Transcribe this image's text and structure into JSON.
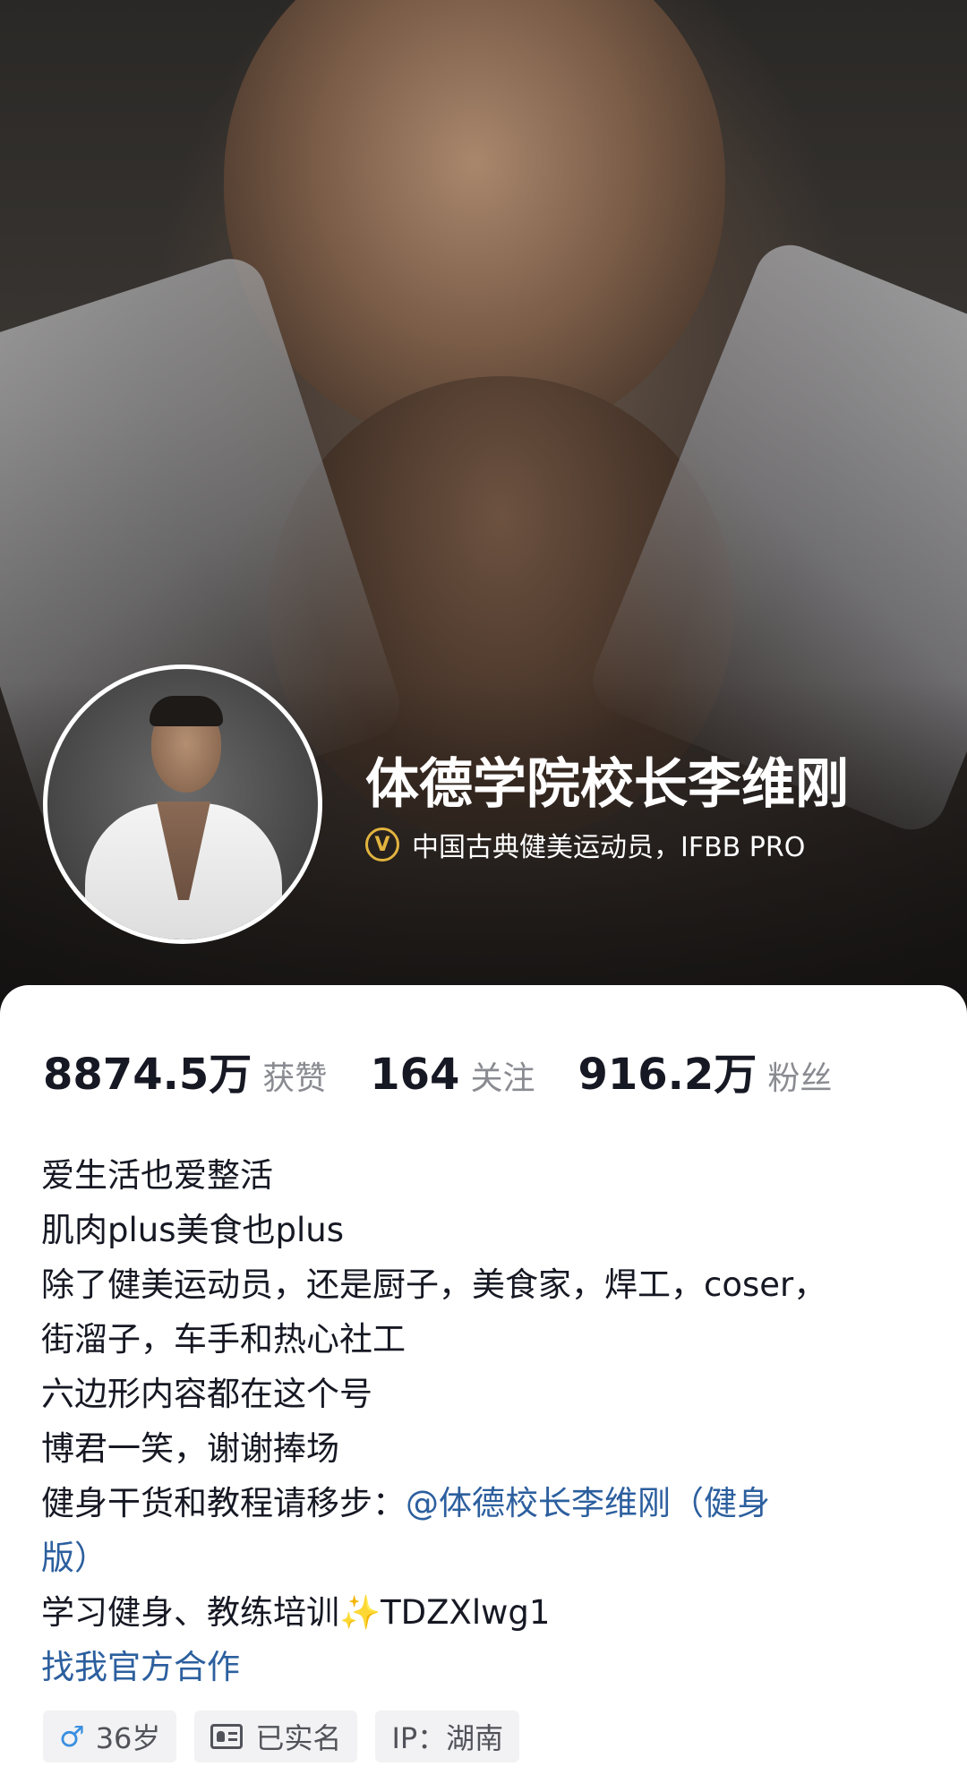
{
  "profile": {
    "name": "体德学院校长李维刚",
    "verify_badge": "V",
    "verify_text": "中国古典健美运动员，IFBB PRO"
  },
  "stats": [
    {
      "value": "8874.5万",
      "label": "获赞"
    },
    {
      "value": "164",
      "label": "关注"
    },
    {
      "value": "916.2万",
      "label": "粉丝"
    }
  ],
  "bio": {
    "line1": "爱生活也爱整活",
    "line2": "肌肉plus美食也plus",
    "line3": "除了健美运动员，还是厨子，美食家，焊工，coser，",
    "line4": "街溜子，车手和热心社工",
    "line5": "六边形内容都在这个号",
    "line6": "博君一笑，谢谢捧场",
    "line7_prefix": "健身干货和教程请移步：",
    "line7_link": "@体德校长李维刚（健身",
    "line8_link": "版）",
    "line9": "学习健身、教练培训✨TDZXlwg1",
    "cooperation_link": "找我官方合作"
  },
  "tags": {
    "gender_icon": "♂",
    "age": "36岁",
    "verified": "已实名",
    "ip": "IP：湖南"
  },
  "colors": {
    "link": "#2c5f9e",
    "badge": "#e2b43f",
    "male": "#3a8fe0"
  }
}
